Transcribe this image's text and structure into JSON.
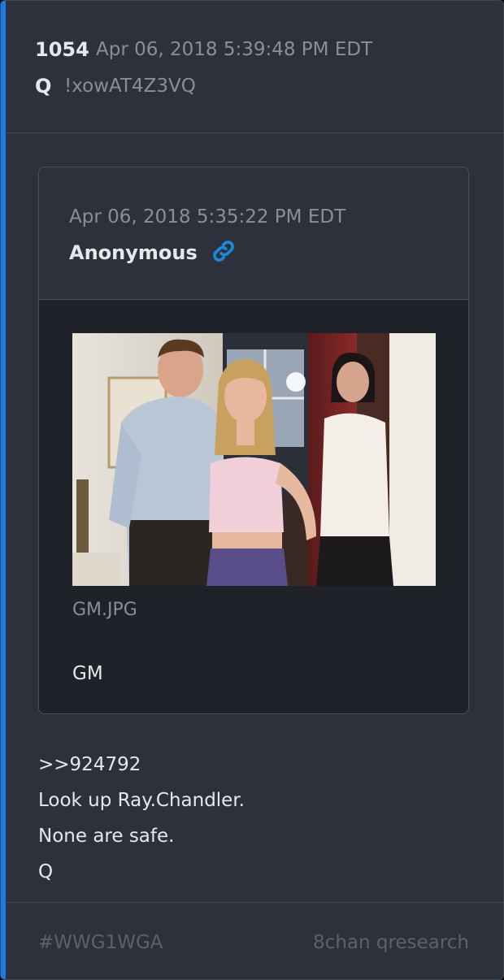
{
  "post": {
    "number": "1054",
    "date": "Apr 06, 2018 5:39:48 PM EDT",
    "name": "Q",
    "tripcode": "!xowAT4Z3VQ"
  },
  "quoted": {
    "date": "Apr 06, 2018 5:35:22 PM EDT",
    "author": "Anonymous",
    "link_icon": "link-icon",
    "image_filename": "GM.JPG",
    "message": "GM"
  },
  "body": {
    "lines": [
      ">>924792",
      "Look up Ray.Chandler.",
      "None are safe.",
      "Q"
    ]
  },
  "footer": {
    "hashtag": "#WWG1WGA",
    "source": "8chan qresearch"
  },
  "colors": {
    "accent": "#1a7be8",
    "card_bg": "#2c313b",
    "quote_bg": "#1f2229",
    "link": "#1a8ad8"
  }
}
